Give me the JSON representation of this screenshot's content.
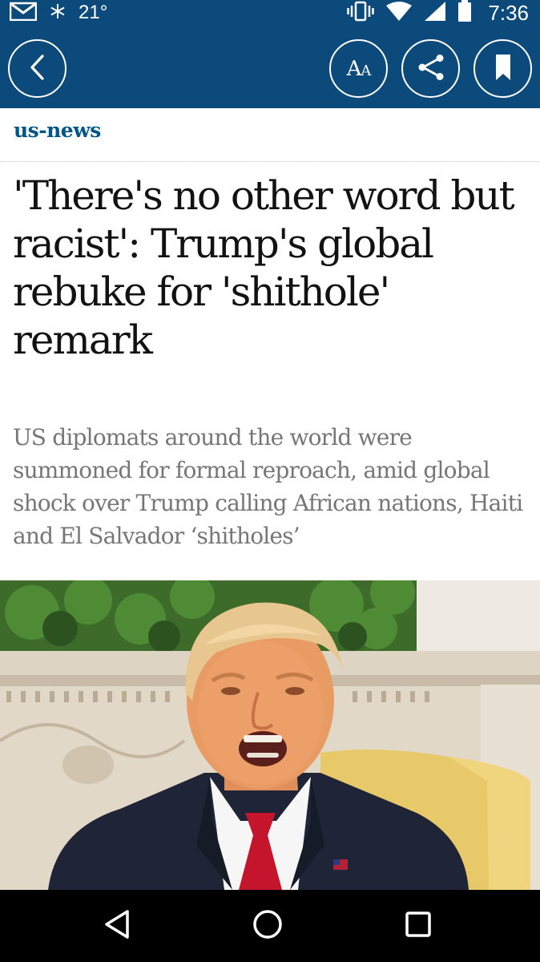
{
  "status_bar": {
    "temperature": "21°",
    "time": "7:36",
    "icons": [
      "gmail-icon",
      "snowflake-icon",
      "vibrate-icon",
      "wifi-icon",
      "signal-icon",
      "battery-icon"
    ]
  },
  "app_bar": {
    "background_color": "#0b4a7a",
    "back_icon": "chevron-left-icon",
    "text_size_label": "AA",
    "share_icon": "share-icon",
    "bookmark_icon": "bookmark-icon"
  },
  "article": {
    "section": "us-news",
    "section_color": "#005689",
    "headline": "'There's no other word but racist': Trump's global rebuke for 'shithole' remark",
    "standfirst": "US diplomats around the world were summoned for formal reproach, amid global shock over Trump calling African nations, Haiti and El Salvador ‘shitholes’",
    "hero_image": "photo-of-trump-speaking-in-oval-office"
  },
  "nav_bar": {
    "icons": [
      "back-triangle-icon",
      "home-circle-icon",
      "recents-square-icon"
    ]
  }
}
